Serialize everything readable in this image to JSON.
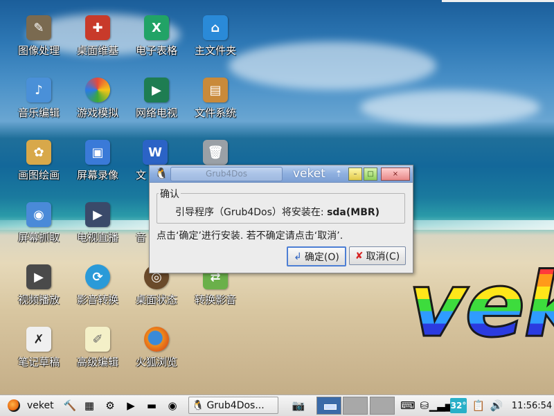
{
  "desktop": {
    "icons": [
      {
        "label": "图像处理",
        "icon": "gimp-icon"
      },
      {
        "label": "桌面维基",
        "icon": "wiki-icon"
      },
      {
        "label": "电子表格",
        "icon": "spreadsheet-icon"
      },
      {
        "label": "主文件夹",
        "icon": "home-folder-icon"
      },
      {
        "label": "音乐编辑",
        "icon": "music-edit-icon"
      },
      {
        "label": "游戏模拟",
        "icon": "game-emulator-icon"
      },
      {
        "label": "网络电视",
        "icon": "network-tv-icon"
      },
      {
        "label": "文件系统",
        "icon": "filesystem-icon"
      },
      {
        "label": "画图绘画",
        "icon": "paint-icon"
      },
      {
        "label": "屏幕录像",
        "icon": "screen-record-icon"
      },
      {
        "label": "文",
        "icon": "word-icon"
      },
      {
        "label": "",
        "icon": "trash-icon"
      },
      {
        "label": "屏幕抓取",
        "icon": "screenshot-icon"
      },
      {
        "label": "电视直播",
        "icon": "live-tv-icon"
      },
      {
        "label": "音",
        "icon": "audio-icon"
      },
      {
        "label": "视频播放",
        "icon": "video-player-icon"
      },
      {
        "label": "影音转换",
        "icon": "media-convert-icon"
      },
      {
        "label": "桌面状态",
        "icon": "desktop-status-icon"
      },
      {
        "label": "转换影音",
        "icon": "convert-media-icon"
      },
      {
        "label": "笔记草稿",
        "icon": "notes-icon"
      },
      {
        "label": "高级编辑",
        "icon": "advanced-editor-icon"
      },
      {
        "label": "火狐浏览",
        "icon": "firefox-icon"
      }
    ],
    "wallpaper_logo": "veket"
  },
  "dialog": {
    "tab_title": "Grub4Dos",
    "window_title": "veket",
    "group_label": "确认",
    "message_prefix": "引导程序（Grub4Dos）将安装在: ",
    "message_target": "sda(MBR)",
    "instruction": "点击‘确定’进行安装. 若不确定请点击‘取消’.",
    "ok_label": "确定(O)",
    "cancel_label": "取消(C)",
    "title_arrow": "⇡",
    "min_glyph": "–",
    "max_glyph": "□",
    "close_glyph": "×"
  },
  "taskbar": {
    "start_label": "veket",
    "task_label": "Grub4Dos...",
    "temperature": "32°",
    "clock": "11:56:54"
  },
  "colors": {
    "title_bar": "#8fb0e0",
    "ok_border": "#4c7ed4",
    "cancel_icon": "#d62424"
  }
}
